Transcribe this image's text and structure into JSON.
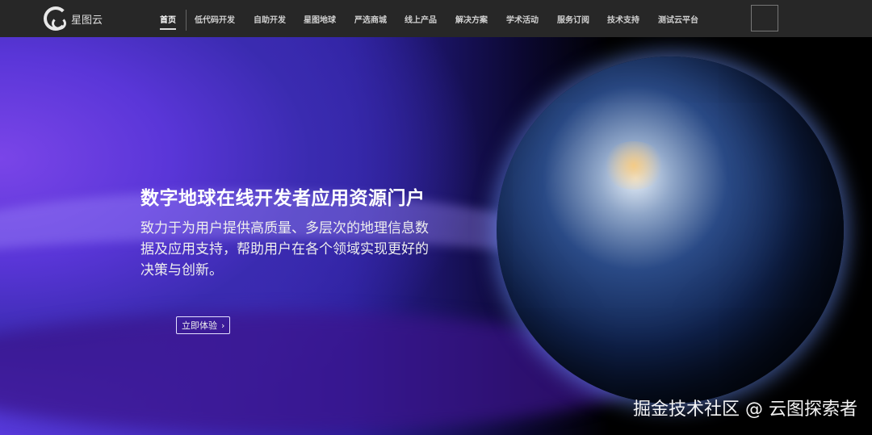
{
  "nav": {
    "logo_text": "星图云",
    "items": [
      "首页",
      "低代码开发",
      "自助开发",
      "星图地球",
      "严选商城",
      "线上产品",
      "解决方案",
      "学术活动",
      "服务订阅",
      "技术支持",
      "测试云平台"
    ],
    "active": "首页"
  },
  "hero": {
    "title": "数字地球在线开发者应用资源门户",
    "description": "致力于为用户提供高质量、多层次的地理信息数据及应用支持，帮助用户在各个领域实现更好的决策与创新。",
    "cta_label": "立即体验",
    "cta_icon": "chevron-right-icon"
  },
  "watermark": "掘金技术社区 @ 云图探索者"
}
